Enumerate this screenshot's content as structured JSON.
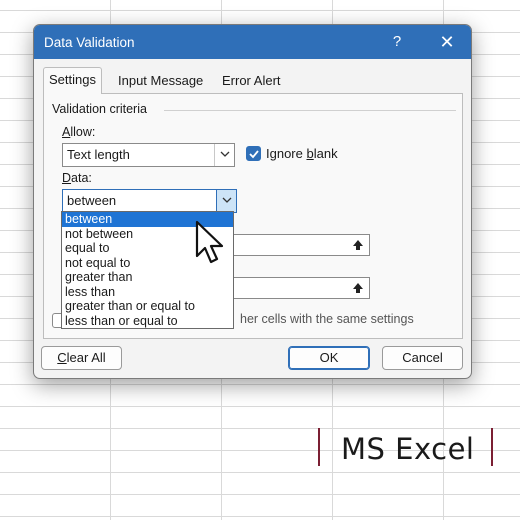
{
  "dialog": {
    "title": "Data Validation",
    "help_glyph": "?",
    "close_glyph": "✕",
    "tabs": [
      {
        "label": "Settings",
        "active": true
      },
      {
        "label": "Input Message",
        "active": false
      },
      {
        "label": "Error Alert",
        "active": false
      }
    ],
    "settings": {
      "group_label": "Validation criteria",
      "allow": {
        "label_prefix": "",
        "label_mnemonic": "A",
        "label_rest": "llow:",
        "value": "Text length"
      },
      "ignore_blank": {
        "label_pre": "Ignore ",
        "label_mnemonic": "b",
        "label_post": "lank",
        "checked": true
      },
      "data": {
        "label_mnemonic": "D",
        "label_rest": "ata:",
        "value": "between"
      },
      "data_options": [
        "between",
        "not between",
        "equal to",
        "not equal to",
        "greater than",
        "less than",
        "greater than or equal to",
        "less than or equal to"
      ],
      "selected_option_index": 0,
      "apply_text_partial": "her cells with the same settings"
    },
    "buttons": {
      "clear_all_mnemonic": "C",
      "clear_all_rest": "lear All",
      "ok": "OK",
      "cancel": "Cancel"
    }
  },
  "caption": "MS Excel",
  "colors": {
    "titlebar": "#2f6fb8",
    "selection": "#1f74d4",
    "caption_bar": "#7b1f33"
  }
}
